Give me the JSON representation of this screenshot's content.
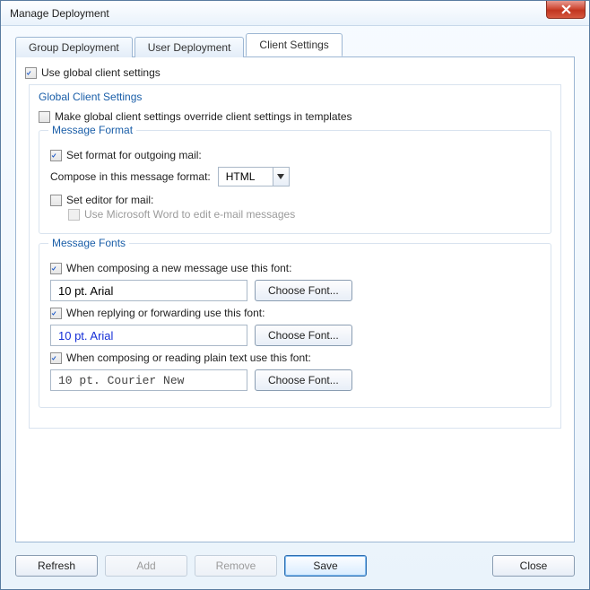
{
  "window": {
    "title": "Manage Deployment"
  },
  "tabs": [
    {
      "label": "Group Deployment"
    },
    {
      "label": "User Deployment"
    },
    {
      "label": "Client Settings"
    }
  ],
  "global": {
    "use_global_label": "Use global client settings",
    "panel_title": "Global Client Settings",
    "override_label": "Make global client settings override client settings in templates"
  },
  "message_format": {
    "legend": "Message Format",
    "set_format_label": "Set format for outgoing mail:",
    "compose_label": "Compose in this message format:",
    "compose_value": "HTML",
    "set_editor_label": "Set editor for mail:",
    "use_word_label": "Use Microsoft Word to edit e-mail messages"
  },
  "message_fonts": {
    "legend": "Message Fonts",
    "compose_label": "When composing a new message use this font:",
    "compose_font": "10 pt. Arial",
    "reply_label": "When replying or forwarding use this font:",
    "reply_font": "10 pt. Arial",
    "plain_label": "When composing or reading plain text use this font:",
    "plain_font": "10 pt. Courier New",
    "choose_label": "Choose Font..."
  },
  "footer": {
    "refresh": "Refresh",
    "add": "Add",
    "remove": "Remove",
    "save": "Save",
    "close": "Close"
  }
}
